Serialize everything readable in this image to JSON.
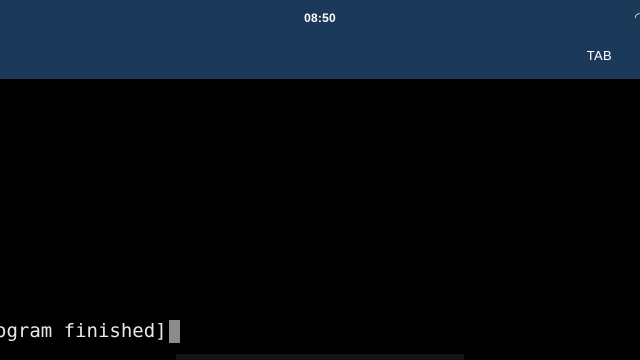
{
  "status_bar": {
    "time": "08:50",
    "status_icon": "signal-icon"
  },
  "toolbar": {
    "tab_label": "TAB"
  },
  "terminal": {
    "last_line": "ogram finished]"
  },
  "colors": {
    "header_bg": "#1b3a59",
    "terminal_bg": "#000000",
    "terminal_text": "#e8e8e8",
    "cursor": "#8c8c8c"
  }
}
